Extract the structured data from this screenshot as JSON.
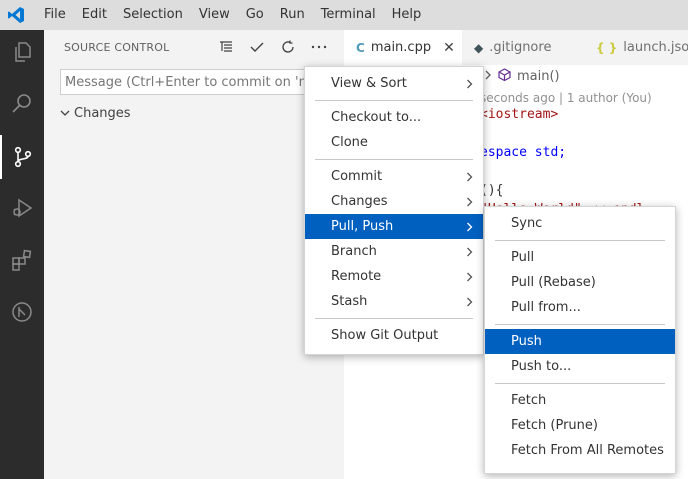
{
  "menubar": {
    "items": [
      "File",
      "Edit",
      "Selection",
      "View",
      "Go",
      "Run",
      "Terminal",
      "Help"
    ]
  },
  "activitybar": {
    "items": [
      "explorer-icon",
      "search-icon",
      "source-control-icon",
      "run-debug-icon",
      "extensions-icon",
      "git-graph-icon"
    ],
    "active": "source-control-icon"
  },
  "sidebar": {
    "title": "SOURCE CONTROL",
    "message_placeholder": "Message (Ctrl+Enter to commit on 'master')",
    "changes_label": "Changes"
  },
  "editor": {
    "tabs": [
      {
        "label": "main.cpp",
        "icon": "C",
        "active": true
      },
      {
        "label": ".gitignore",
        "icon": "◆",
        "active": false
      },
      {
        "label": "launch.json",
        "icon": "{ }",
        "active": false
      }
    ],
    "breadcrumb": "main()",
    "codelens": "seconds ago | 1 author (You)",
    "code_lines": [
      "<iostream>",
      "espace std;",
      "(){"
    ],
    "partial_string": "\"Hello World\" << endl;"
  },
  "context_menu": {
    "items": [
      {
        "label": "View & Sort",
        "submenu": true
      },
      {
        "separator": true
      },
      {
        "label": "Checkout to...",
        "submenu": false
      },
      {
        "label": "Clone",
        "submenu": false
      },
      {
        "separator": true
      },
      {
        "label": "Commit",
        "submenu": true
      },
      {
        "label": "Changes",
        "submenu": true
      },
      {
        "label": "Pull, Push",
        "submenu": true,
        "highlighted": true
      },
      {
        "label": "Branch",
        "submenu": true
      },
      {
        "label": "Remote",
        "submenu": true
      },
      {
        "label": "Stash",
        "submenu": true
      },
      {
        "separator": true
      },
      {
        "label": "Show Git Output",
        "submenu": false
      }
    ]
  },
  "submenu": {
    "items": [
      {
        "label": "Sync"
      },
      {
        "separator": true
      },
      {
        "label": "Pull"
      },
      {
        "label": "Pull (Rebase)"
      },
      {
        "label": "Pull from..."
      },
      {
        "separator": true
      },
      {
        "label": "Push",
        "highlighted": true
      },
      {
        "label": "Push to..."
      },
      {
        "separator": true
      },
      {
        "label": "Fetch"
      },
      {
        "label": "Fetch (Prune)"
      },
      {
        "label": "Fetch From All Remotes"
      }
    ]
  },
  "colors": {
    "highlight": "#0060c0",
    "activitybar": "#2c2c2c",
    "vscode_blue": "#0078d4"
  }
}
